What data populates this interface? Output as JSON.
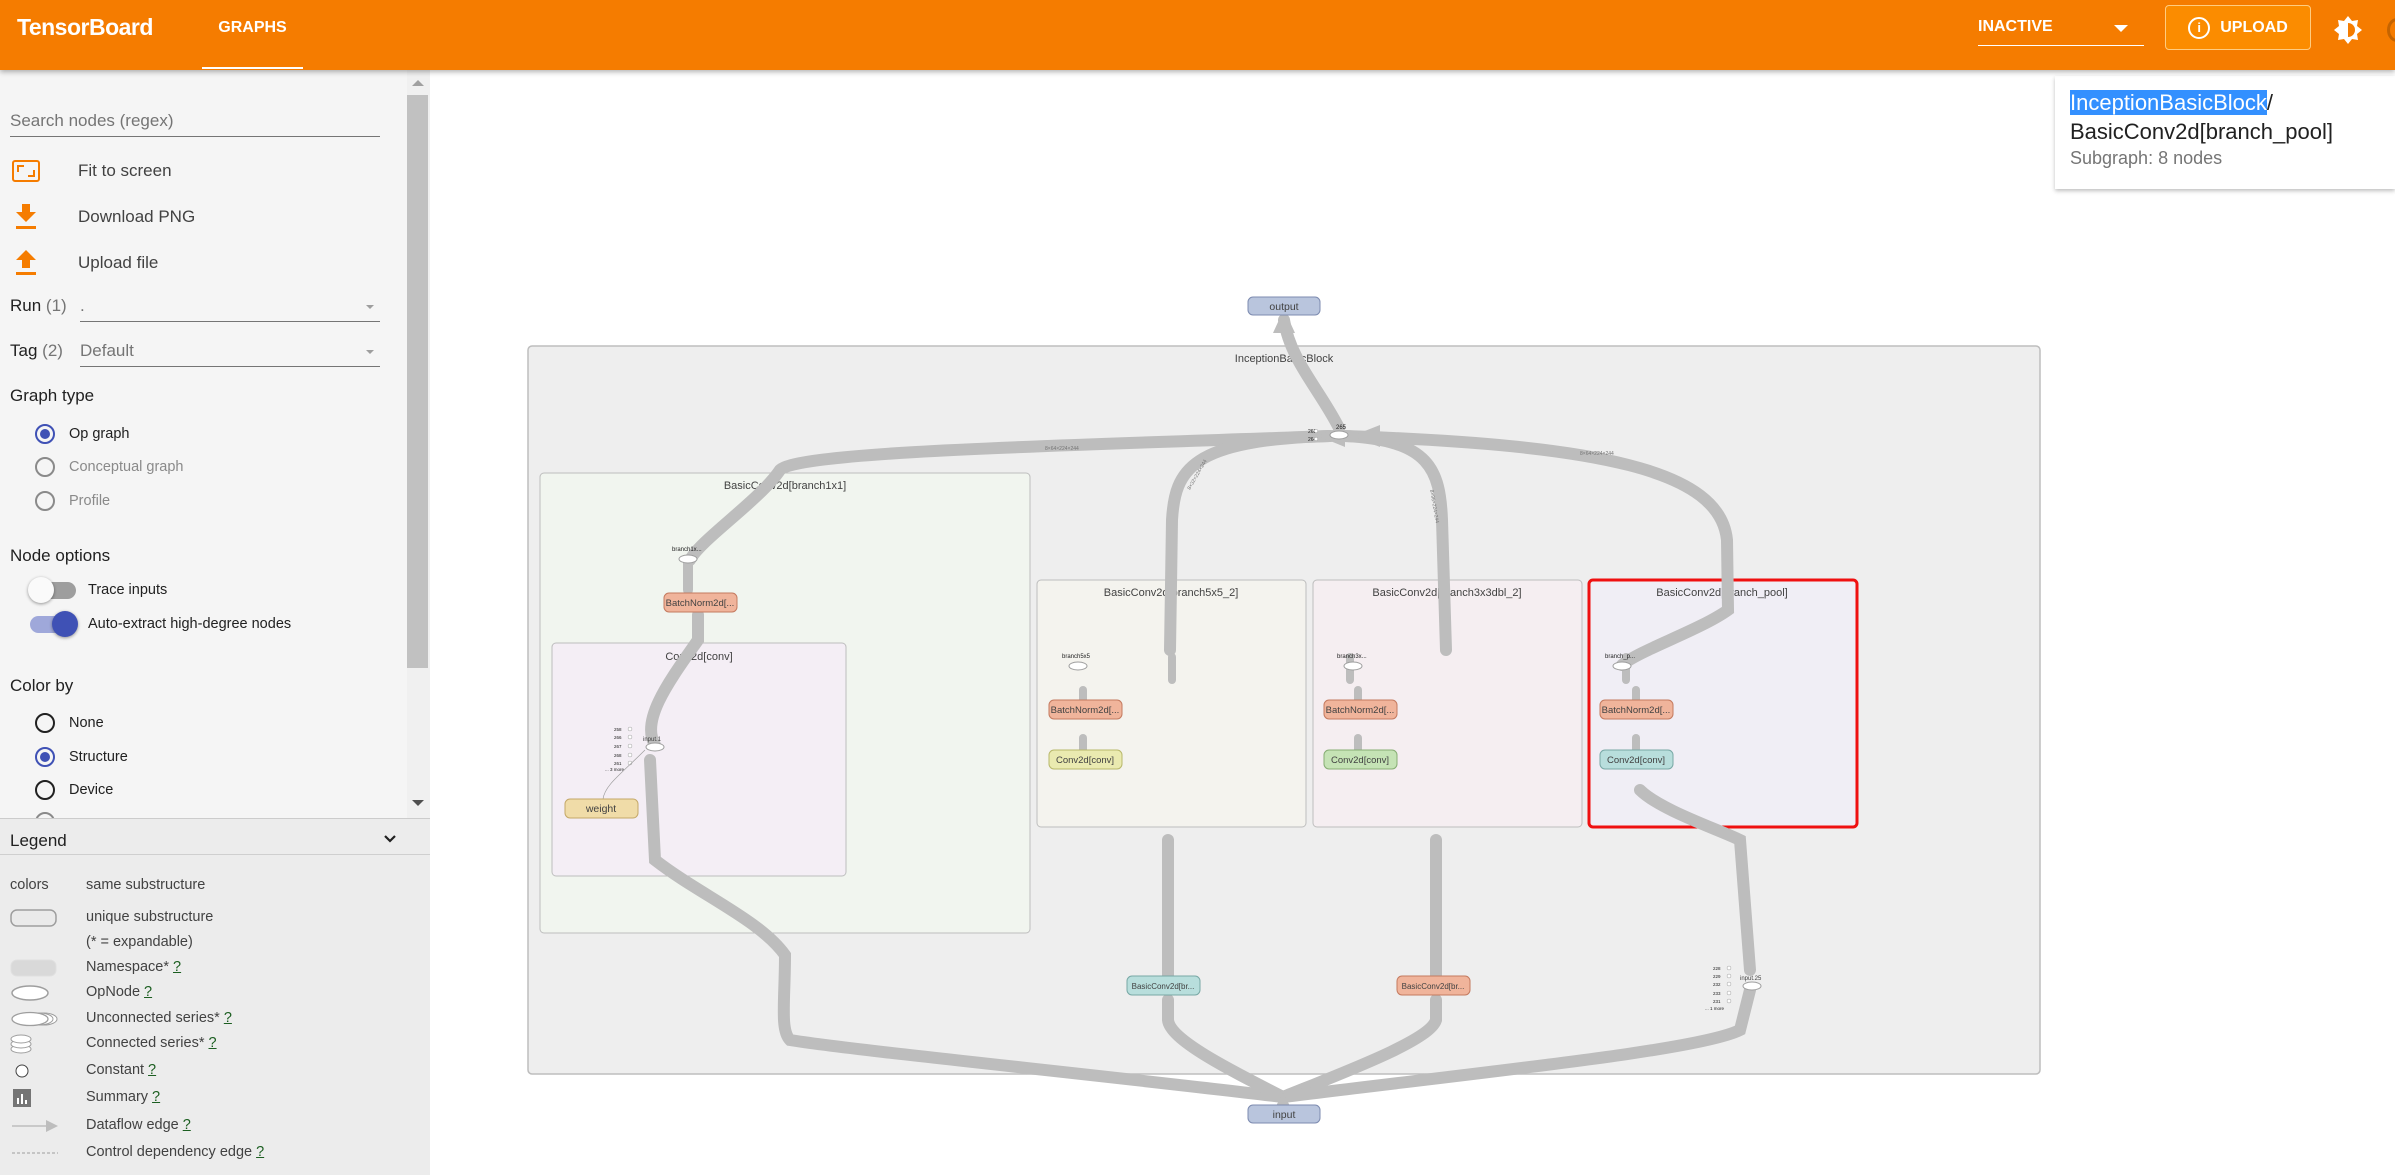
{
  "header": {
    "brand": "TensorBoard",
    "tab": "GRAPHS",
    "reload_status": "INACTIVE",
    "upload_label": "UPLOAD",
    "accent_color": "#f57c00"
  },
  "sidebar": {
    "search_placeholder": "Search nodes (regex)",
    "search_value": "",
    "actions": [
      {
        "label": "Fit to screen",
        "icon": "fit-to-screen-icon"
      },
      {
        "label": "Download PNG",
        "icon": "download-icon"
      },
      {
        "label": "Upload file",
        "icon": "upload-icon"
      }
    ],
    "run": {
      "label": "Run",
      "count": "(1)",
      "value": "."
    },
    "tag": {
      "label": "Tag",
      "count": "(2)",
      "value": "Default"
    },
    "graph_type": {
      "title": "Graph type",
      "options": [
        {
          "label": "Op graph",
          "selected": true,
          "enabled": true
        },
        {
          "label": "Conceptual graph",
          "selected": false,
          "enabled": false
        },
        {
          "label": "Profile",
          "selected": false,
          "enabled": false
        }
      ]
    },
    "node_options": {
      "title": "Node options",
      "toggles": [
        {
          "label": "Trace inputs",
          "on": false
        },
        {
          "label": "Auto-extract high-degree nodes",
          "on": true
        }
      ]
    },
    "color_by": {
      "title": "Color by",
      "options": [
        {
          "label": "None",
          "selected": false
        },
        {
          "label": "Structure",
          "selected": true
        },
        {
          "label": "Device",
          "selected": false
        }
      ]
    }
  },
  "legend": {
    "title": "Legend",
    "rows": [
      {
        "symbol": "colors",
        "label": "same substructure",
        "help": ""
      },
      {
        "symbol": "",
        "label": "unique substructure",
        "help": ""
      },
      {
        "symbol": "",
        "label": "(* = expandable)",
        "help": ""
      },
      {
        "symbol": "",
        "label": "Namespace*",
        "help": "?"
      },
      {
        "symbol": "",
        "label": "OpNode",
        "help": "?"
      },
      {
        "symbol": "",
        "label": "Unconnected series*",
        "help": "?"
      },
      {
        "symbol": "",
        "label": "Connected series*",
        "help": "?"
      },
      {
        "symbol": "",
        "label": "Constant",
        "help": "?"
      },
      {
        "symbol": "",
        "label": "Summary",
        "help": "?"
      },
      {
        "symbol": "",
        "label": "Dataflow edge",
        "help": "?"
      },
      {
        "symbol": "",
        "label": "Control dependency edge",
        "help": "?"
      }
    ]
  },
  "info_card": {
    "path_highlight": "InceptionBasicBlock",
    "path_sep": "/",
    "path_rest": "BasicConv2d[branch_pool]",
    "subtitle": "Subgraph: 8 nodes"
  },
  "graph": {
    "outer_block": "InceptionBasicBlock",
    "top_node": "output",
    "bottom_node": "input",
    "concat_node": "265",
    "concat_inputs": [
      "263",
      "264"
    ],
    "blocks": [
      {
        "title": "BasicConv2d[branch1x1]",
        "out_label": "branch1x...",
        "bn": "BatchNorm2d[...",
        "conv_title": "Conv2d[conv]",
        "conv_node": "input.1",
        "weight": "weight",
        "consts": [
          "258",
          "266",
          "267",
          "268",
          "261"
        ],
        "more": "... 3 more"
      },
      {
        "title": "BasicConv2d[branch5x5_2]",
        "out_label": "branch5x5",
        "bn": "BatchNorm2d[...",
        "conv": "Conv2d[conv]"
      },
      {
        "title": "BasicConv2d[branch3x3dbl_2]",
        "out_label": "branch3x...",
        "bn": "BatchNorm2d[...",
        "conv": "Conv2d[conv]"
      },
      {
        "title": "BasicConv2d[branch_pool]",
        "out_label": "branch_p...",
        "bn": "BatchNorm2d[...",
        "conv": "Conv2d[conv]",
        "selected": true
      }
    ],
    "collapsed_nodes": [
      "BasicConv2d[br...",
      "BasicConv2d[br..."
    ],
    "pool_node": "input.25",
    "pool_consts": [
      "228",
      "229",
      "232",
      "233",
      "231"
    ],
    "pool_more": "... 1 more",
    "edge_labels": [
      "8×64×224×244",
      "8×64×224×244",
      "8×96×224×244",
      "8×32×224×244"
    ]
  }
}
